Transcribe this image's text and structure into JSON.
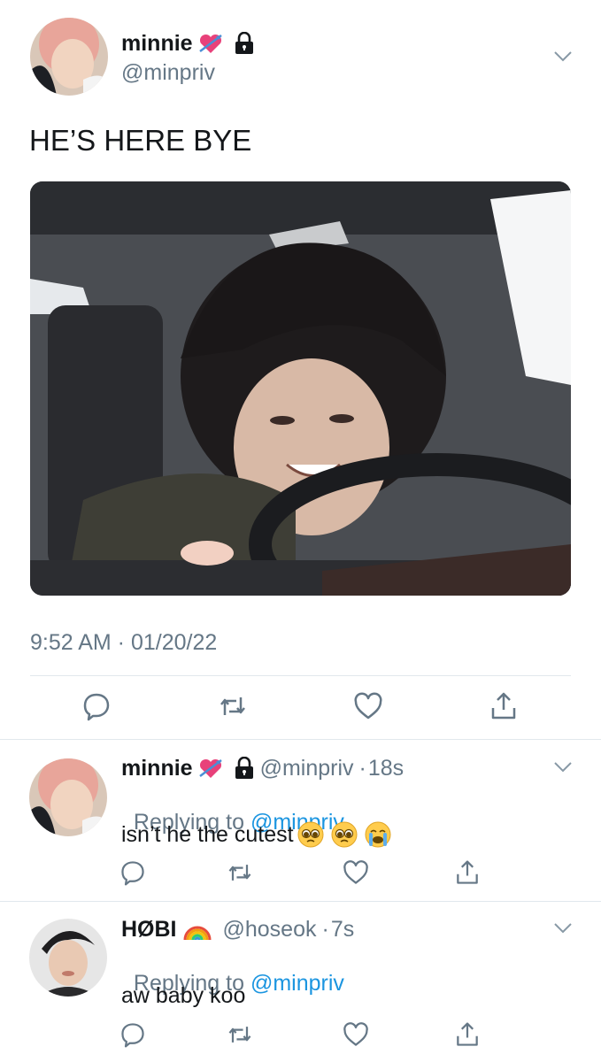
{
  "tweet": {
    "name": "minnie",
    "handle": "@minpriv",
    "text": "HE’S HERE BYE",
    "timestamp": "9:52 AM · 01/20/22"
  },
  "replies": [
    {
      "name": "minnie",
      "handle": "@minpriv",
      "sep": "·",
      "time": "18s",
      "replying_prefix": "Replying to ",
      "replying_to": "@minpriv",
      "text": "isn’t he the cutest"
    },
    {
      "name": "HØBI",
      "handle": "@hoseok",
      "sep": "·",
      "time": "7s",
      "replying_prefix": "Replying to ",
      "replying_to": "@minpriv",
      "text": "aw baby koo"
    }
  ],
  "colors": {
    "link": "#1b95e0",
    "secondary": "#657786",
    "divider": "#e1e8ed",
    "heart_emoji": "#e8417a"
  },
  "icons": [
    "heart-arrow-emoji",
    "lock-icon",
    "chevron-down-icon",
    "reply-icon",
    "retweet-icon",
    "like-icon",
    "share-icon",
    "pleading-face-emoji",
    "crying-face-emoji",
    "rainbow-emoji"
  ]
}
